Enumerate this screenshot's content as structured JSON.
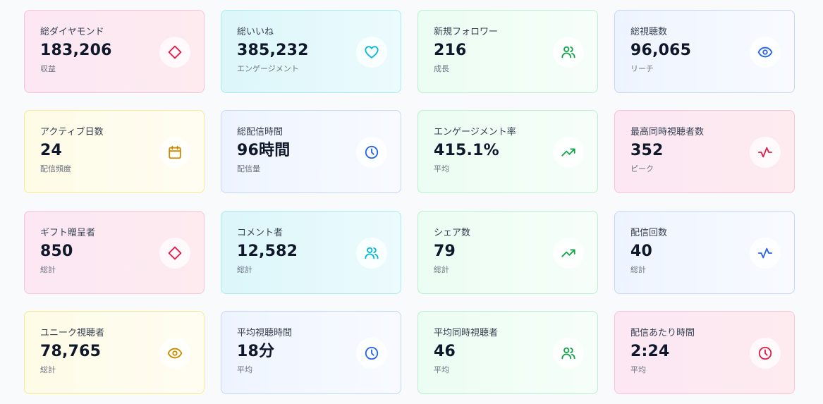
{
  "cards": [
    {
      "label": "総ダイヤモンド",
      "value": "183,206",
      "sub": "収益",
      "icon": "diamond-icon",
      "theme": "pink"
    },
    {
      "label": "総いいね",
      "value": "385,232",
      "sub": "エンゲージメント",
      "icon": "heart-icon",
      "theme": "cyan"
    },
    {
      "label": "新規フォロワー",
      "value": "216",
      "sub": "成長",
      "icon": "users-icon",
      "theme": "green"
    },
    {
      "label": "総視聴数",
      "value": "96,065",
      "sub": "リーチ",
      "icon": "eye-icon",
      "theme": "blue"
    },
    {
      "label": "アクティブ日数",
      "value": "24",
      "sub": "配信頻度",
      "icon": "calendar-icon",
      "theme": "yellow"
    },
    {
      "label": "総配信時間",
      "value": "96時間",
      "sub": "配信量",
      "icon": "clock-icon",
      "theme": "blue"
    },
    {
      "label": "エンゲージメント率",
      "value": "415.1%",
      "sub": "平均",
      "icon": "trending-up-icon",
      "theme": "green"
    },
    {
      "label": "最高同時視聴者数",
      "value": "352",
      "sub": "ピーク",
      "icon": "activity-icon",
      "theme": "pink"
    },
    {
      "label": "ギフト贈呈者",
      "value": "850",
      "sub": "総計",
      "icon": "diamond-icon",
      "theme": "pink"
    },
    {
      "label": "コメント者",
      "value": "12,582",
      "sub": "総計",
      "icon": "users-icon",
      "theme": "cyan"
    },
    {
      "label": "シェア数",
      "value": "79",
      "sub": "総計",
      "icon": "trending-up-icon",
      "theme": "green"
    },
    {
      "label": "配信回数",
      "value": "40",
      "sub": "総計",
      "icon": "activity-icon",
      "theme": "blue"
    },
    {
      "label": "ユニーク視聴者",
      "value": "78,765",
      "sub": "総計",
      "icon": "eye-icon",
      "theme": "yellow"
    },
    {
      "label": "平均視聴時間",
      "value": "18分",
      "sub": "平均",
      "icon": "clock-icon",
      "theme": "blue"
    },
    {
      "label": "平均同時視聴者",
      "value": "46",
      "sub": "平均",
      "icon": "users-icon",
      "theme": "green"
    },
    {
      "label": "配信あたり時間",
      "value": "2:24",
      "sub": "平均",
      "icon": "clock-icon",
      "theme": "pink"
    }
  ],
  "colors": {
    "pink": "#e11d48",
    "cyan": "#06b6d4",
    "green": "#16a34a",
    "blue": "#2563eb",
    "yellow": "#ca8a04"
  }
}
